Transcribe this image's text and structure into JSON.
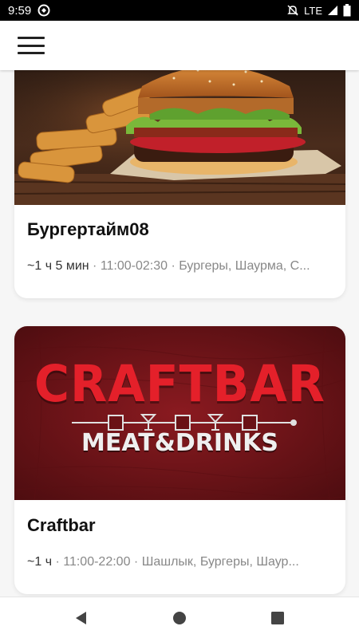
{
  "status_bar": {
    "time": "9:59",
    "network": "LTE"
  },
  "icons": {
    "menu": "hamburger-menu-icon",
    "back": "back-triangle-icon",
    "home": "home-circle-icon",
    "recents": "recents-square-icon"
  },
  "restaurants": [
    {
      "name": "Бургертайм08",
      "eta": "~1 ч 5 мин",
      "hours": "11:00-02:30",
      "cuisines": "Бургеры, Шаурма, С..."
    },
    {
      "name": "Craftbar",
      "eta": "~1 ч",
      "hours": "11:00-22:00",
      "cuisines": "Шашлык, Бургеры, Шаур..."
    }
  ],
  "craftbar_logo": {
    "title": "CRAFTBAR",
    "subtitle": "MEAT&DRINKS"
  },
  "separator": " · ",
  "colors": {
    "logo_red": "#e4202a",
    "logo_bg": "#6e1418"
  }
}
